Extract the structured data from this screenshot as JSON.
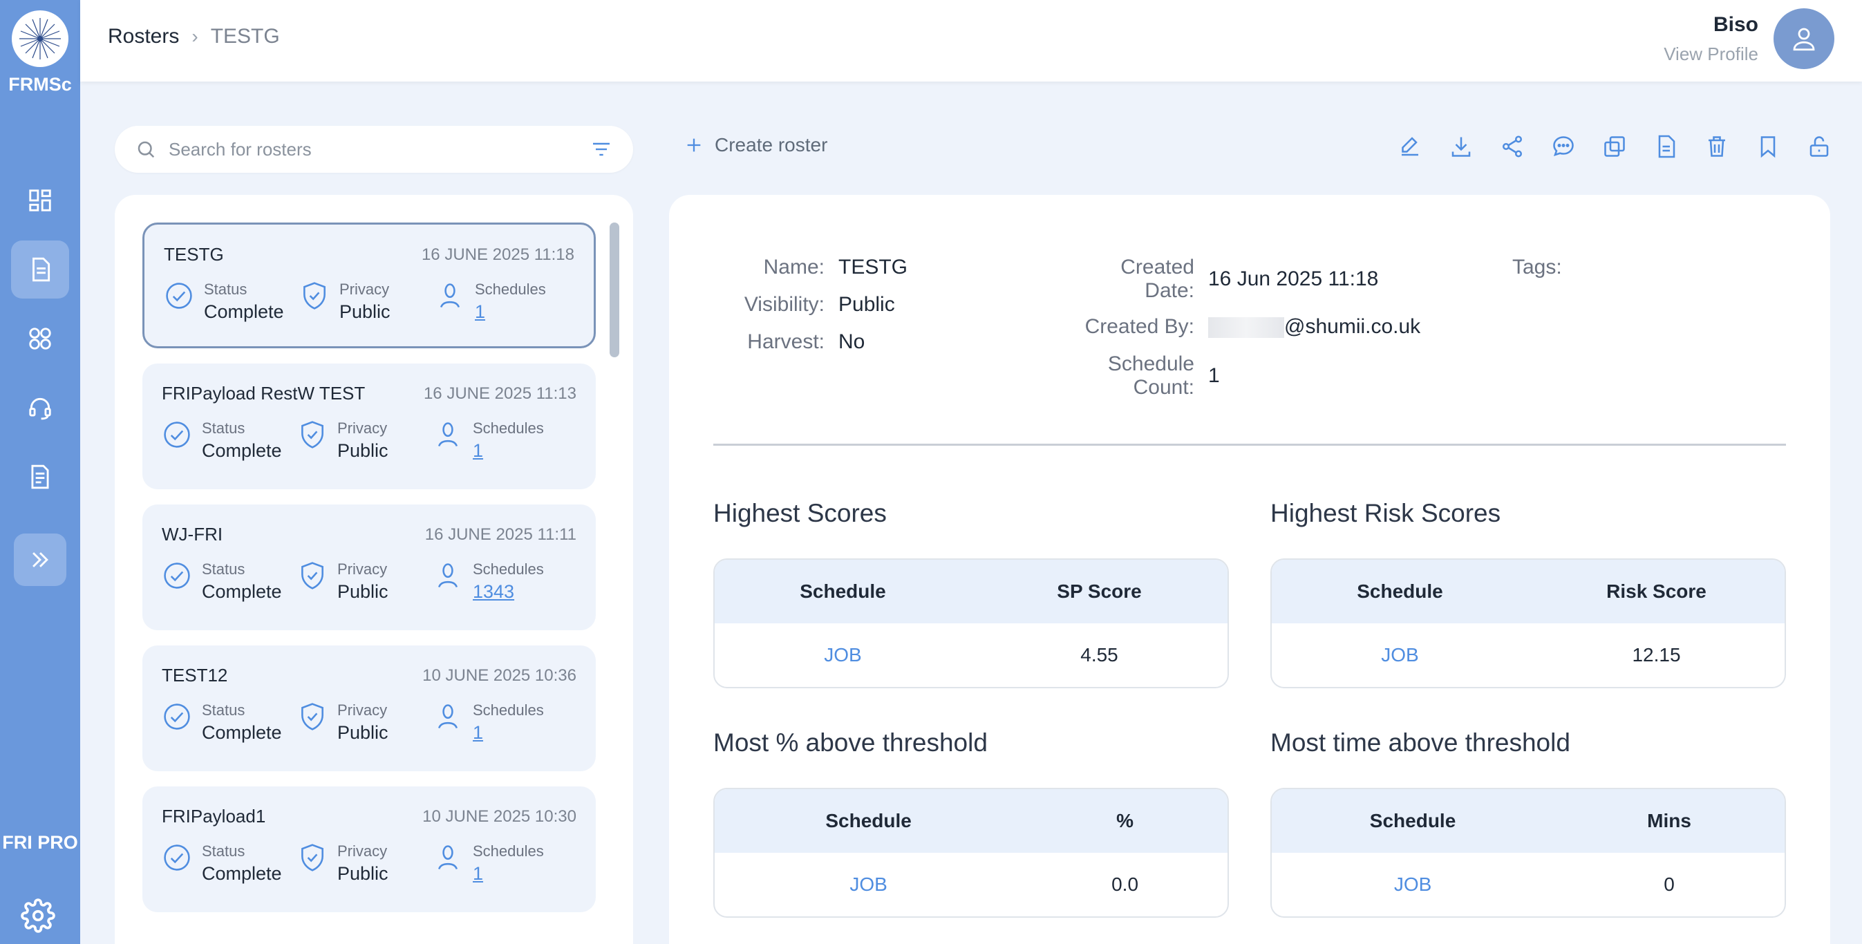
{
  "app": {
    "brand": "FRMSc",
    "plan": "FRI PRO"
  },
  "breadcrumb": {
    "root": "Rosters",
    "current": "TESTG"
  },
  "profile": {
    "name": "Biso",
    "link": "View Profile"
  },
  "search": {
    "placeholder": "Search for rosters"
  },
  "create_label": "Create roster",
  "labels": {
    "status": "Status",
    "privacy": "Privacy",
    "schedules": "Schedules"
  },
  "rosters": [
    {
      "name": "TESTG",
      "date": "16 JUNE 2025 11:18",
      "status": "Complete",
      "privacy": "Public",
      "schedules": "1"
    },
    {
      "name": "FRIPayload RestW TEST",
      "date": "16 JUNE 2025 11:13",
      "status": "Complete",
      "privacy": "Public",
      "schedules": "1"
    },
    {
      "name": "WJ-FRI",
      "date": "16 JUNE 2025 11:11",
      "status": "Complete",
      "privacy": "Public",
      "schedules": "1343"
    },
    {
      "name": "TEST12",
      "date": "10 JUNE 2025 10:36",
      "status": "Complete",
      "privacy": "Public",
      "schedules": "1"
    },
    {
      "name": "FRIPayload1",
      "date": "10 JUNE 2025 10:30",
      "status": "Complete",
      "privacy": "Public",
      "schedules": "1"
    }
  ],
  "detail": {
    "name_label": "Name:",
    "name": "TESTG",
    "visibility_label": "Visibility:",
    "visibility": "Public",
    "harvest_label": "Harvest:",
    "harvest": "No",
    "created_date_label_1": "Created",
    "created_date_label_2": "Date:",
    "created_date": "16 Jun 2025 11:18",
    "created_by_label": "Created By:",
    "created_by": "@shumii.co.uk",
    "schedule_count_label_1": "Schedule",
    "schedule_count_label_2": "Count:",
    "schedule_count": "1",
    "tags_label": "Tags:"
  },
  "tables": {
    "highest": {
      "title": "Highest Scores",
      "col_a": "Schedule",
      "col_b": "SP Score",
      "row_a": "JOB",
      "row_b": "4.55"
    },
    "risk": {
      "title": "Highest Risk Scores",
      "col_a": "Schedule",
      "col_b": "Risk Score",
      "row_a": "JOB",
      "row_b": "12.15"
    },
    "pct": {
      "title": "Most % above threshold",
      "col_a": "Schedule",
      "col_b": "%",
      "row_a": "JOB",
      "row_b": "0.0"
    },
    "time": {
      "title": "Most time above threshold",
      "col_a": "Schedule",
      "col_b": "Mins",
      "row_a": "JOB",
      "row_b": "0"
    }
  },
  "colors": {
    "sidebar": "#6a98dc",
    "accent": "#4f8de0",
    "card_bg": "#eef3fb"
  },
  "icons": [
    "dashboard-icon",
    "document-icon",
    "apps-icon",
    "headset-icon",
    "report-icon",
    "expand-icon",
    "settings-icon",
    "pencil-icon",
    "download-icon",
    "share-icon",
    "comment-icon",
    "copy-icon",
    "file-icon",
    "trash-icon",
    "bookmark-icon",
    "unlock-icon"
  ]
}
